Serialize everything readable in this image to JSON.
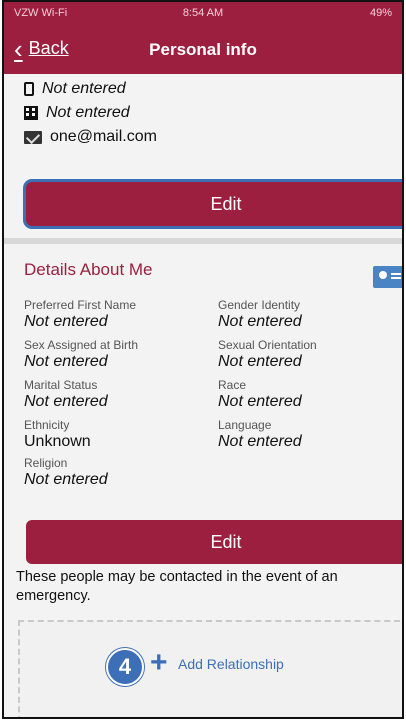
{
  "status_bar": {
    "carrier": "VZW Wi-Fi",
    "time": "8:54 AM",
    "battery": "49%"
  },
  "nav": {
    "back_label": "Back",
    "title": "Personal info"
  },
  "contact": {
    "phone": "Not entered",
    "work_phone": "Not entered",
    "email": "one@mail.com",
    "edit_label": "Edit"
  },
  "details": {
    "heading": "Details About Me",
    "edit_label": "Edit",
    "fields": [
      {
        "label": "Preferred First Name",
        "value": "Not entered"
      },
      {
        "label": "Gender Identity",
        "value": "Not entered"
      },
      {
        "label": "Sex Assigned at Birth",
        "value": "Not entered"
      },
      {
        "label": "Sexual Orientation",
        "value": "Not entered"
      },
      {
        "label": "Marital Status",
        "value": "Not entered"
      },
      {
        "label": "Race",
        "value": "Not entered"
      },
      {
        "label": "Ethnicity",
        "value": "Unknown"
      },
      {
        "label": "Language",
        "value": "Not entered"
      },
      {
        "label": "Religion",
        "value": "Not entered"
      }
    ]
  },
  "emergency": {
    "note": "These people may be contacted in the event of an emergency.",
    "badge": "4",
    "add_label": "Add Relationship"
  },
  "colors": {
    "brand": "#9d1f3f",
    "accent": "#3d6fb6"
  }
}
